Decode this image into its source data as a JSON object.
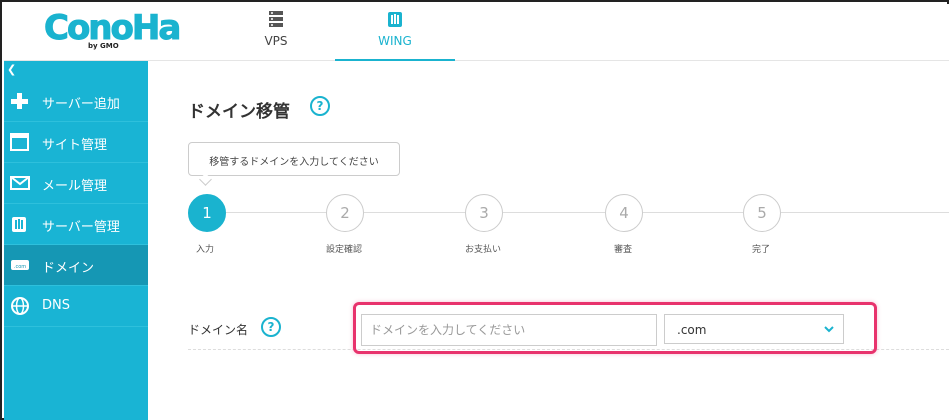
{
  "logo": {
    "text": "ConoHa",
    "sub": "by GMO"
  },
  "nav": {
    "tabs": [
      {
        "label": "VPS",
        "icon": "server-icon"
      },
      {
        "label": "WING",
        "icon": "wing-icon",
        "active": true
      }
    ]
  },
  "sidebar": {
    "collapse": "❮",
    "items": [
      {
        "label": "サーバー追加",
        "icon": "plus-icon"
      },
      {
        "label": "サイト管理",
        "icon": "window-icon"
      },
      {
        "label": "メール管理",
        "icon": "mail-icon"
      },
      {
        "label": "サーバー管理",
        "icon": "server-manage-icon"
      },
      {
        "label": "ドメイン",
        "icon": "domain-icon",
        "active": true
      },
      {
        "label": "DNS",
        "icon": "globe-icon"
      }
    ]
  },
  "main": {
    "title": "ドメイン移管",
    "help": "?",
    "tooltip": "移管するドメインを入力してください",
    "steps": [
      {
        "num": "1",
        "label": "入力",
        "active": true
      },
      {
        "num": "2",
        "label": "設定確認"
      },
      {
        "num": "3",
        "label": "お支払い"
      },
      {
        "num": "4",
        "label": "審査"
      },
      {
        "num": "5",
        "label": "完了"
      }
    ],
    "form": {
      "label": "ドメイン名",
      "help": "?",
      "placeholder": "ドメインを入力してください",
      "tld": ".com"
    }
  },
  "colors": {
    "accent": "#19b4d4",
    "active": "#1597b4",
    "highlight": "#e8336d"
  }
}
